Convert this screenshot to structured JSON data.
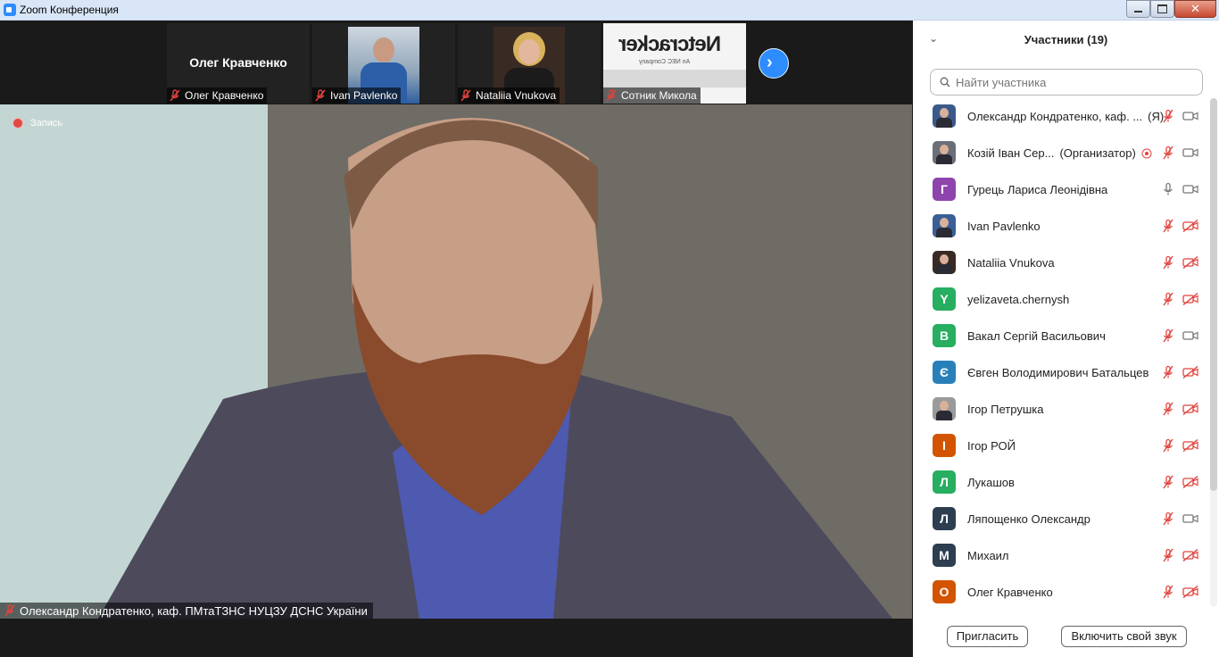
{
  "window": {
    "title": "Zoom Конференция"
  },
  "thumbnails": [
    {
      "display": "Олег Кравченко",
      "name": "Олег Кравченко",
      "type": "name"
    },
    {
      "name": "Ivan Pavlenko",
      "type": "video"
    },
    {
      "name": "Nataliia Vnukova",
      "type": "video"
    },
    {
      "name": "Сотник Микола",
      "type": "video",
      "logo_text": "Netcracker",
      "logo_sub": "An NEC Company"
    }
  ],
  "recording": {
    "label": "Запись"
  },
  "main_speaker": {
    "name": "Олександр Кондратенко, каф. ПМтаТЗНС НУЦЗУ ДСНС України"
  },
  "participants_panel": {
    "title": "Участники (19)",
    "search_placeholder": "Найти участника",
    "participants": [
      {
        "name": "Олександр Кондратенко, каф. ...",
        "suffix": "(Я)",
        "avatar": "photo",
        "mic": "muted",
        "cam": "on"
      },
      {
        "name": "Козій Іван Сер...",
        "suffix": "(Организатор)",
        "avatar": "photo",
        "mic": "muted",
        "cam": "on",
        "extra": "record-icon"
      },
      {
        "name": "Гурець Лариса Леонідівна",
        "avatar": "Г",
        "color": "#8e44ad",
        "mic": "on",
        "cam": "on"
      },
      {
        "name": "Ivan Pavlenko",
        "avatar": "photo",
        "mic": "muted",
        "cam": "off"
      },
      {
        "name": "Nataliia Vnukova",
        "avatar": "photo",
        "mic": "muted",
        "cam": "off"
      },
      {
        "name": "yelizaveta.chernysh",
        "avatar": "Y",
        "color": "#27ae60",
        "mic": "muted",
        "cam": "off"
      },
      {
        "name": "Вакал Сергій Васильович",
        "avatar": "В",
        "color": "#27ae60",
        "mic": "muted",
        "cam": "on"
      },
      {
        "name": "Євген Володимирович Батальцев",
        "avatar": "Є",
        "color": "#2980b9",
        "mic": "muted",
        "cam": "off"
      },
      {
        "name": "Ігор Петрушка",
        "avatar": "photo",
        "mic": "muted",
        "cam": "off"
      },
      {
        "name": "Ігор РОЙ",
        "avatar": "I",
        "color": "#d35400",
        "mic": "muted",
        "cam": "off"
      },
      {
        "name": "Лукашов",
        "avatar": "Л",
        "color": "#27ae60",
        "mic": "muted",
        "cam": "off"
      },
      {
        "name": "Ляпощенко Олександр",
        "avatar": "Л",
        "color": "#2c3e50",
        "mic": "muted",
        "cam": "on"
      },
      {
        "name": "Михаил",
        "avatar": "М",
        "color": "#2c3e50",
        "mic": "muted",
        "cam": "off"
      },
      {
        "name": "Олег Кравченко",
        "avatar": "О",
        "color": "#d35400",
        "mic": "muted",
        "cam": "off"
      }
    ],
    "invite_label": "Пригласить",
    "unmute_label": "Включить свой звук"
  },
  "colors": {
    "accent": "#2d8cff",
    "muted_red": "#e0443e"
  }
}
